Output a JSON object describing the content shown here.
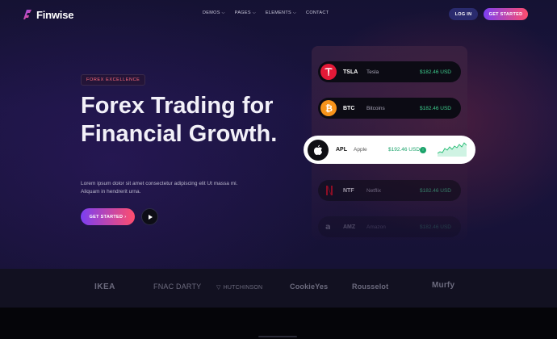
{
  "brand": {
    "name": "Finwise",
    "logo": "finwise-logo-icon"
  },
  "nav": {
    "items": [
      {
        "label": "DEMOS",
        "dropdown": true
      },
      {
        "label": "PAGES",
        "dropdown": true
      },
      {
        "label": "ELEMENTS",
        "dropdown": true
      },
      {
        "label": "CONTACT",
        "dropdown": false
      }
    ],
    "login_label": "LOG IN",
    "get_started_label": "GET STARTED"
  },
  "hero": {
    "badge": "FOREX EXCELLENCE",
    "headline": "Forex Trading for Financial Growth.",
    "description": "Lorem ipsum dolor sit amet consectetur adipiscing elit Ut massa mi. Aliquam in hendrerit urna.",
    "cta_label": "GET STARTED",
    "cta_arrow": "›",
    "play_icon": "play-icon"
  },
  "stocks": [
    {
      "ticker": "TSLA",
      "name": "Tesla",
      "price": "$182.46 USD",
      "icon": "tesla-icon",
      "color": "#e31937"
    },
    {
      "ticker": "BTC",
      "name": "Bitcoins",
      "price": "$182.46 USD",
      "icon": "bitcoin-icon",
      "color": "#f7931a"
    },
    {
      "ticker": "APL",
      "name": "Apple",
      "price": "$192.46 USD",
      "icon": "apple-icon",
      "color": "#0f0f14",
      "active": true
    },
    {
      "ticker": "NTF",
      "name": "Netflix",
      "price": "$182.46 USD",
      "icon": "netflix-icon",
      "color": "#e50914"
    },
    {
      "ticker": "AMZ",
      "name": "Amazon",
      "price": "$182.46 USD",
      "icon": "amazon-icon",
      "color": "#ffffff"
    }
  ],
  "partners": [
    "IKEA",
    "FNAC DARTY",
    "HUTCHINSON",
    "CookieYes",
    "Rousselot",
    "Murfy"
  ],
  "colors": {
    "accent_start": "#7b3ff2",
    "accent_end": "#ff4d6d",
    "positive": "#3ecf8e"
  }
}
